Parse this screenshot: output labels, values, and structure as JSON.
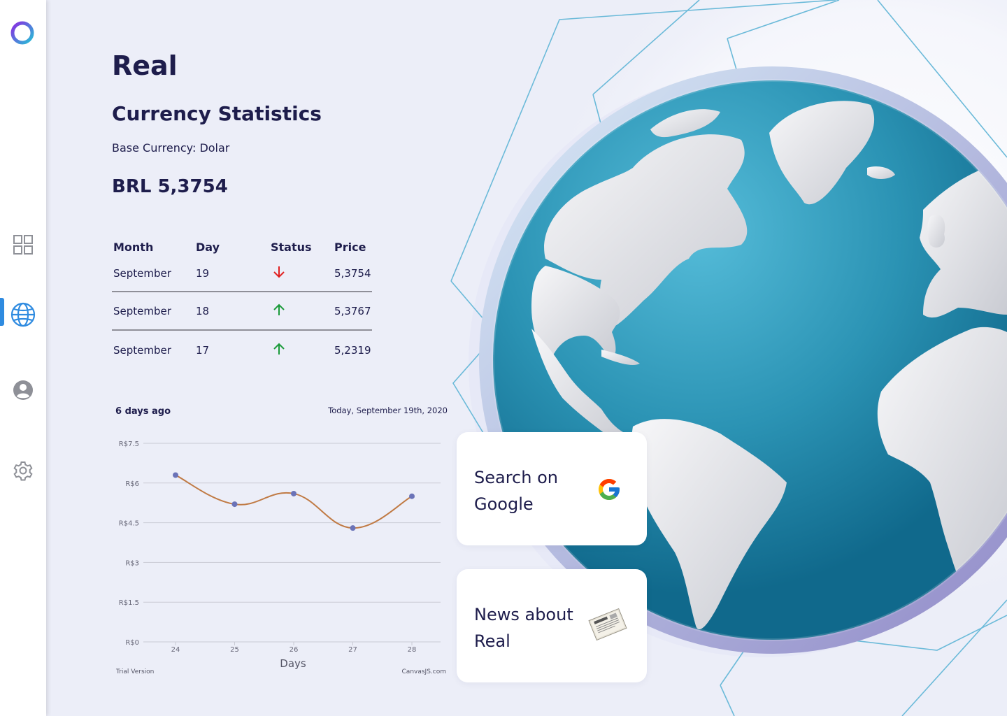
{
  "nav": {
    "items": [
      {
        "name": "dashboard",
        "icon": "grid-icon",
        "active": false
      },
      {
        "name": "world",
        "icon": "globe-icon",
        "active": true
      },
      {
        "name": "profile",
        "icon": "user-icon",
        "active": false
      },
      {
        "name": "settings",
        "icon": "gear-icon",
        "active": false
      }
    ]
  },
  "page": {
    "title": "Real",
    "subtitle": "Currency Statistics",
    "base_currency": "Base Currency: Dolar",
    "rate": "BRL 5,3754"
  },
  "table": {
    "headers": [
      "Month",
      "Day",
      "Status",
      "Price"
    ],
    "rows": [
      {
        "month": "September",
        "day": "19",
        "status": "down",
        "price": "5,3754"
      },
      {
        "month": "September",
        "day": "18",
        "status": "up",
        "price": "5,3767"
      },
      {
        "month": "September",
        "day": "17",
        "status": "up",
        "price": "5,2319"
      }
    ]
  },
  "colors": {
    "navy": "#1e1d4c",
    "accent": "#2f8be0",
    "down": "#e01e1e",
    "up": "#1a9a3a",
    "line": "#c07a44",
    "point": "#6b73b8"
  },
  "chart_data": {
    "type": "line",
    "header_left": "6 days ago",
    "header_right": "Today, September 19th, 2020",
    "xlabel": "Days",
    "ylabel": "",
    "footer_left": "Trial Version",
    "footer_right": "CanvasJS.com",
    "x": [
      24,
      25,
      26,
      27,
      28
    ],
    "values": [
      6.3,
      5.2,
      5.6,
      4.3,
      5.5
    ],
    "ylim": [
      0,
      7.5
    ],
    "yticks": [
      0,
      1.5,
      3,
      4.5,
      6,
      7.5
    ],
    "ytick_labels": [
      "R$0",
      "R$1.5",
      "R$3",
      "R$4.5",
      "R$6",
      "R$7.5"
    ],
    "grid": true
  },
  "cards": {
    "google": {
      "text": "Search on Google",
      "icon": "google-icon"
    },
    "news": {
      "text": "News about Real",
      "icon": "newspaper-icon"
    }
  }
}
